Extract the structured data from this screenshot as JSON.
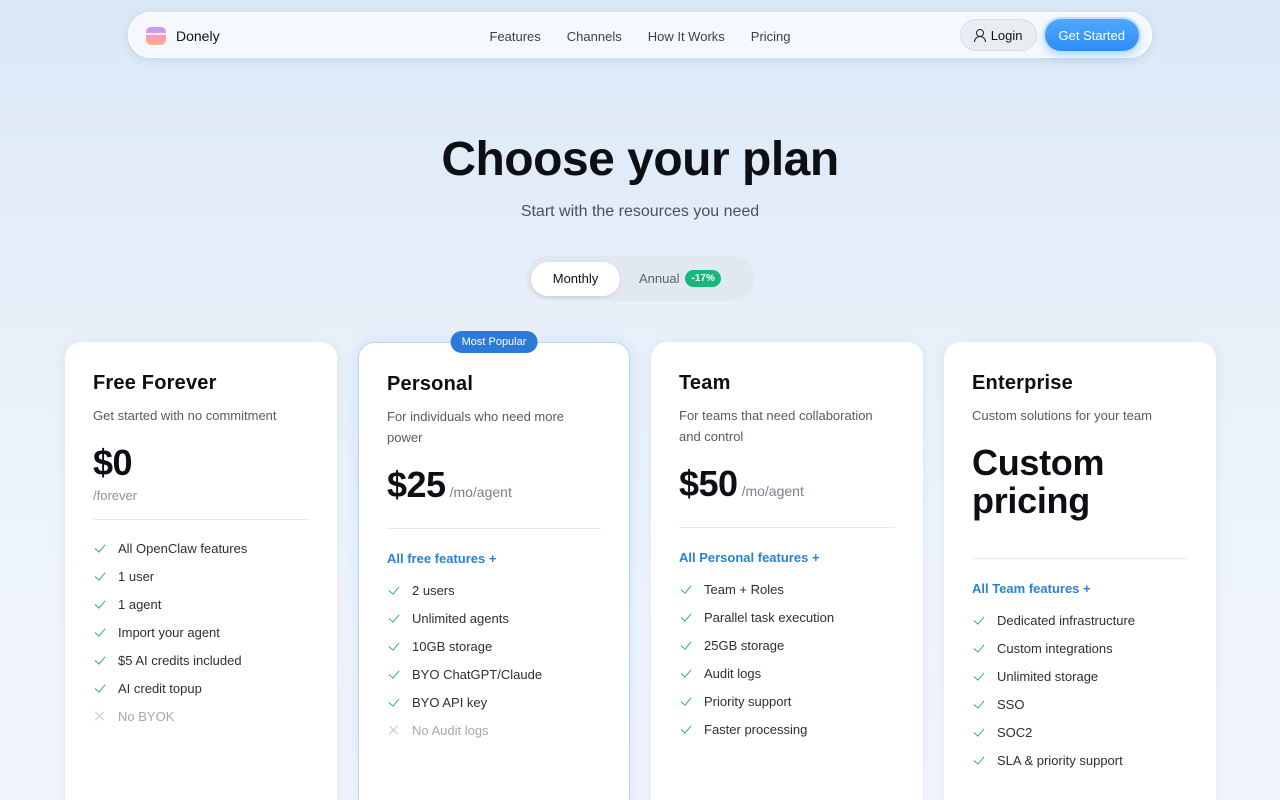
{
  "nav": {
    "brand": "Donely",
    "links": [
      "Features",
      "Channels",
      "How It Works",
      "Pricing"
    ],
    "login": "Login",
    "get_started": "Get Started"
  },
  "hero": {
    "title": "Choose your plan",
    "subtitle": "Start with the resources you need"
  },
  "billing_toggle": {
    "monthly": "Monthly",
    "annual": "Annual",
    "discount": "-17%",
    "selected": "Monthly"
  },
  "colors": {
    "accent": "#2f8cf5",
    "check": "#2fb27a",
    "discount": "#18b87a",
    "link": "#2b82d4"
  },
  "plans": [
    {
      "name": "Free Forever",
      "description": "Get started with no commitment",
      "price": "$0",
      "period": "/forever",
      "includes": "",
      "features": [
        {
          "text": "All OpenClaw features",
          "included": true
        },
        {
          "text": "1 user",
          "included": true
        },
        {
          "text": "1 agent",
          "included": true
        },
        {
          "text": "Import your agent",
          "included": true
        },
        {
          "text": "$5 AI credits included",
          "included": true
        },
        {
          "text": "AI credit topup",
          "included": true
        },
        {
          "text": "No BYOK",
          "included": false
        }
      ]
    },
    {
      "name": "Personal",
      "badge": "Most Popular",
      "description": "For individuals who need more power",
      "price": "$25",
      "period": "/mo/agent",
      "includes": "All free features +",
      "features": [
        {
          "text": "2 users",
          "included": true
        },
        {
          "text": "Unlimited agents",
          "included": true
        },
        {
          "text": "10GB storage",
          "included": true
        },
        {
          "text": "BYO ChatGPT/Claude",
          "included": true
        },
        {
          "text": "BYO API key",
          "included": true
        },
        {
          "text": "No Audit logs",
          "included": false
        }
      ]
    },
    {
      "name": "Team",
      "description": "For teams that need collaboration and control",
      "price": "$50",
      "period": "/mo/agent",
      "includes": "All Personal features +",
      "features": [
        {
          "text": "Team + Roles",
          "included": true
        },
        {
          "text": "Parallel task execution",
          "included": true
        },
        {
          "text": "25GB storage",
          "included": true
        },
        {
          "text": "Audit logs",
          "included": true
        },
        {
          "text": "Priority support",
          "included": true
        },
        {
          "text": "Faster processing",
          "included": true
        }
      ]
    },
    {
      "name": "Enterprise",
      "description": "Custom solutions for your team",
      "price": "Custom pricing",
      "period": "",
      "includes": "All Team features +",
      "features": [
        {
          "text": "Dedicated infrastructure",
          "included": true
        },
        {
          "text": "Custom integrations",
          "included": true
        },
        {
          "text": "Unlimited storage",
          "included": true
        },
        {
          "text": "SSO",
          "included": true
        },
        {
          "text": "SOC2",
          "included": true
        },
        {
          "text": "SLA & priority support",
          "included": true
        }
      ]
    }
  ]
}
